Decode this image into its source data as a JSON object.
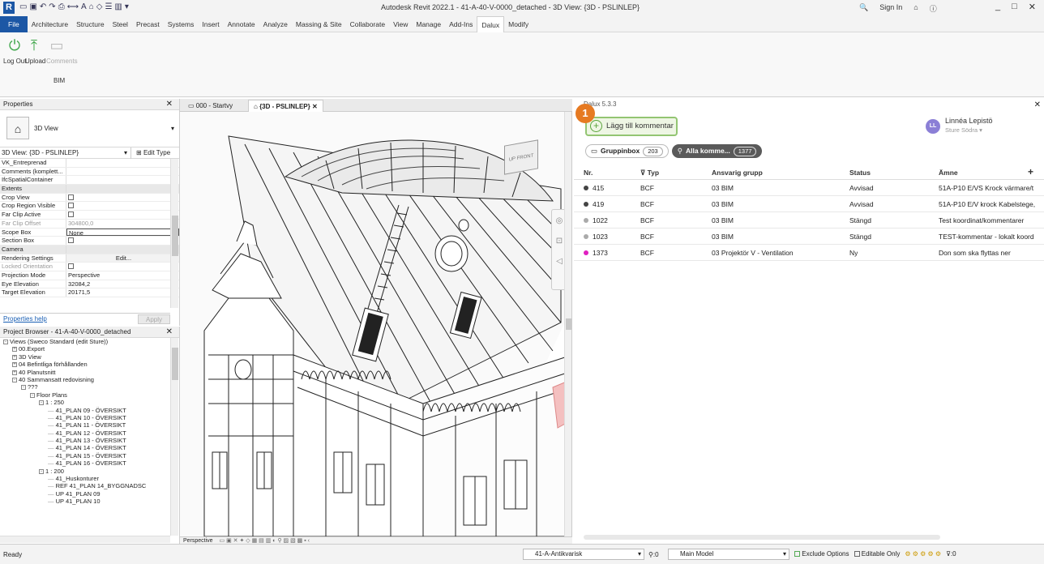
{
  "titlebar": {
    "title": "Autodesk Revit 2022.1 - 41-A-40-V-0000_detached - 3D View: {3D - PSLINLEP}",
    "sign_in": "Sign In",
    "minimize": "_",
    "restore": "□",
    "close": "✕"
  },
  "ribbon_tabs": [
    "File",
    "Architecture",
    "Structure",
    "Steel",
    "Precast",
    "Systems",
    "Insert",
    "Annotate",
    "Analyze",
    "Massing & Site",
    "Collaborate",
    "View",
    "Manage",
    "Add-Ins",
    "Dalux",
    "Modify"
  ],
  "active_tab": "Dalux",
  "ribbon": {
    "log_out": "Log Out",
    "upload": "Upload",
    "comments": "Comments",
    "panel": "BIM"
  },
  "properties": {
    "header": "Properties",
    "type_name": "3D View",
    "instance": "3D View: {3D - PSLINLEP}",
    "edit_type": "Edit Type",
    "rows": [
      {
        "k": "VK_Entreprenad",
        "v": "",
        "cat": false
      },
      {
        "k": "Comments (komplett...",
        "v": "",
        "cat": false
      },
      {
        "k": "IfcSpatialContainer",
        "v": "",
        "cat": false
      },
      {
        "k": "Extents",
        "v": "",
        "cat": true
      },
      {
        "k": "Crop View",
        "v": "",
        "cat": false,
        "cb": true
      },
      {
        "k": "Crop Region Visible",
        "v": "",
        "cat": false,
        "cb": true
      },
      {
        "k": "Far Clip Active",
        "v": "",
        "cat": false,
        "cb": true
      },
      {
        "k": "Far Clip Offset",
        "v": "304800,0",
        "cat": false,
        "dim": true
      },
      {
        "k": "Scope Box",
        "v": "None",
        "cat": false
      },
      {
        "k": "Section Box",
        "v": "",
        "cat": false,
        "cb": true
      },
      {
        "k": "Camera",
        "v": "",
        "cat": true
      },
      {
        "k": "Rendering Settings",
        "v": "Edit...",
        "cat": false
      },
      {
        "k": "Locked Orientation",
        "v": "",
        "cat": false,
        "dim": true,
        "cb": true
      },
      {
        "k": "Projection Mode",
        "v": "Perspective",
        "cat": false
      },
      {
        "k": "Eye Elevation",
        "v": "32084,2",
        "cat": false
      },
      {
        "k": "Target Elevation",
        "v": "20171,5",
        "cat": false
      }
    ],
    "help": "Properties help",
    "apply": "Apply"
  },
  "browser": {
    "header": "Project Browser - 41-A-40-V-0000_detached",
    "items": [
      {
        "t": "Views (Sweco Standard (edit Sture))",
        "lvl": 0,
        "exp": "-"
      },
      {
        "t": "00.Export",
        "lvl": 1,
        "exp": "+"
      },
      {
        "t": "3D View",
        "lvl": 1,
        "exp": "+"
      },
      {
        "t": "04 Befintliga förhållanden",
        "lvl": 1,
        "exp": "+"
      },
      {
        "t": "40 Planutsnitt",
        "lvl": 1,
        "exp": "+"
      },
      {
        "t": "40 Sammansatt redovisning",
        "lvl": 1,
        "exp": "-"
      },
      {
        "t": "???",
        "lvl": 2,
        "exp": "-"
      },
      {
        "t": "Floor Plans",
        "lvl": 3,
        "exp": "-"
      },
      {
        "t": "1 : 250",
        "lvl": 4,
        "exp": "-"
      },
      {
        "t": "41_PLAN 09 - ÖVERSIKT",
        "lvl": 5,
        "exp": ""
      },
      {
        "t": "41_PLAN 10 - ÖVERSIKT",
        "lvl": 5,
        "exp": ""
      },
      {
        "t": "41_PLAN 11 - ÖVERSIKT",
        "lvl": 5,
        "exp": ""
      },
      {
        "t": "41_PLAN 12 - ÖVERSIKT",
        "lvl": 5,
        "exp": ""
      },
      {
        "t": "41_PLAN 13 - ÖVERSIKT",
        "lvl": 5,
        "exp": ""
      },
      {
        "t": "41_PLAN 14 - ÖVERSIKT",
        "lvl": 5,
        "exp": ""
      },
      {
        "t": "41_PLAN 15 - ÖVERSIKT",
        "lvl": 5,
        "exp": ""
      },
      {
        "t": "41_PLAN 16 - ÖVERSIKT",
        "lvl": 5,
        "exp": ""
      },
      {
        "t": "1 : 200",
        "lvl": 4,
        "exp": "-"
      },
      {
        "t": "41_Huskonturer",
        "lvl": 5,
        "exp": ""
      },
      {
        "t": "REF 41_PLAN 14_BYGGNADSC",
        "lvl": 5,
        "exp": ""
      },
      {
        "t": "UP 41_PLAN 09",
        "lvl": 5,
        "exp": ""
      },
      {
        "t": "UP 41_PLAN 10",
        "lvl": 5,
        "exp": ""
      }
    ]
  },
  "view_tabs": [
    "000 - Startvy",
    "{3D - PSLINLEP}"
  ],
  "viewbar": {
    "mode": "Perspective"
  },
  "viewcube": {
    "top": "UP",
    "front": "FRONT"
  },
  "dalux": {
    "title": "Dalux 5.3.3",
    "add_comment": "Lägg till kommentar",
    "step_badge": "1",
    "user_name": "Linnéa Lepistö",
    "user_initials": "LL",
    "user_sub": "Sture Södra ▾",
    "filter_group": "Gruppinbox",
    "filter_group_count": "203",
    "filter_all": "Alla komme...",
    "filter_all_count": "1377",
    "columns": [
      "Nr.",
      "Typ",
      "Ansvarig grupp",
      "Status",
      "Ämne"
    ],
    "rows": [
      {
        "nr": "415",
        "typ": "BCF",
        "grupp": "03 BIM",
        "status": "Avvisad",
        "amne": "51A-P10 E/VS Krock värmare/t",
        "color": "#444444"
      },
      {
        "nr": "419",
        "typ": "BCF",
        "grupp": "03 BIM",
        "status": "Avvisad",
        "amne": "51A-P10 E/V krock Kabelstege,",
        "color": "#444444"
      },
      {
        "nr": "1022",
        "typ": "BCF",
        "grupp": "03 BIM",
        "status": "Stängd",
        "amne": "Test koordinat/kommentarer",
        "color": "#aaaaaa"
      },
      {
        "nr": "1023",
        "typ": "BCF",
        "grupp": "03 BIM",
        "status": "Stängd",
        "amne": "TEST-kommentar - lokalt koord",
        "color": "#aaaaaa"
      },
      {
        "nr": "1373",
        "typ": "BCF",
        "grupp": "03 Projektör V - Ventilation",
        "status": "Ny",
        "amne": "Don som ska flyttas ner",
        "color": "#e020c0"
      }
    ]
  },
  "statusbar": {
    "ready": "Ready",
    "workset": "41-A-Antikvarisk",
    "zero": ":0",
    "model": "Main Model",
    "exclude": "Exclude Options",
    "editable": "Editable Only",
    "filter": ":0"
  },
  "colors": {
    "accent": "#1c57a5",
    "dalux_green": "#93c572",
    "badge": "#e67a22"
  }
}
